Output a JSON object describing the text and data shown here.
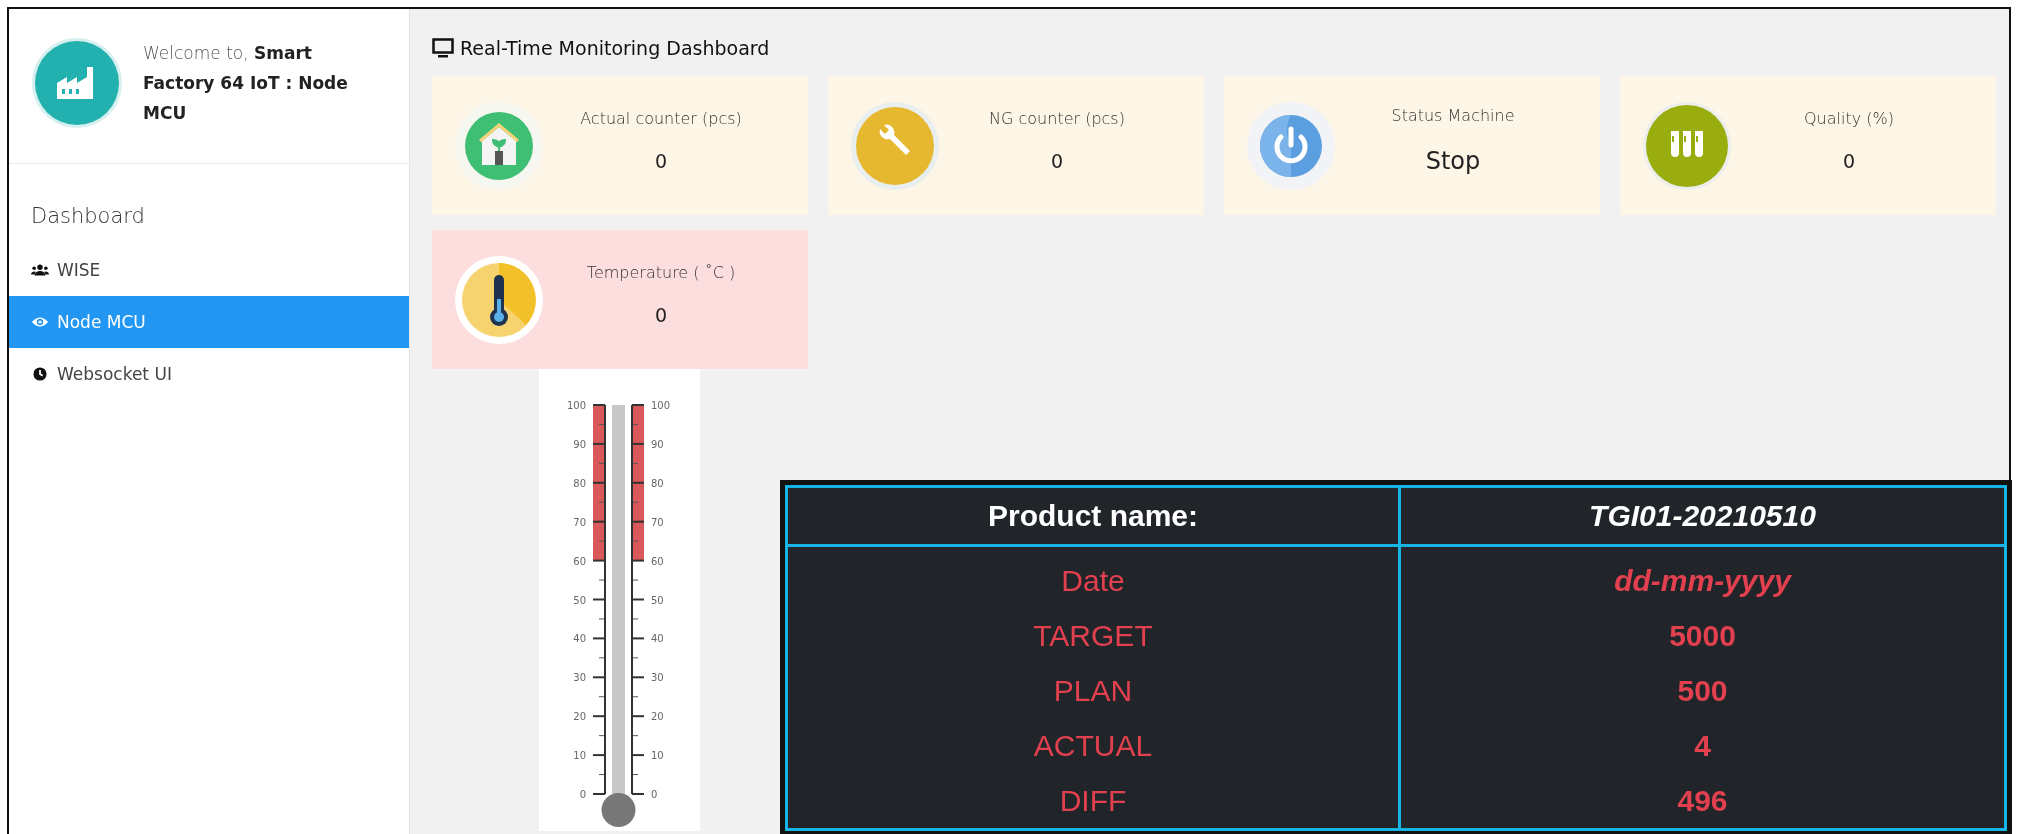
{
  "sidebar": {
    "welcome": "Welcome to, **Smart Factory 64 IoT : Node MCU**",
    "section": "Dashboard",
    "items": [
      {
        "label": "WISE",
        "selected": false
      },
      {
        "label": "Node MCU",
        "selected": true
      },
      {
        "label": "Websocket UI",
        "selected": false
      }
    ]
  },
  "title": "Real-Time Monitoring Dashboard",
  "cards": [
    {
      "label": "Actual counter (pcs)",
      "value": "0",
      "kind": "counter",
      "color": "#fdf5e6"
    },
    {
      "label": "NG counter (pcs)",
      "value": "0",
      "kind": "counter",
      "color": "#fdf5e6"
    },
    {
      "label": "Status Machine",
      "value": "Stop",
      "kind": "status",
      "color": "#fdf5e6"
    },
    {
      "label": "Quality (%)",
      "value": "0",
      "kind": "counter",
      "color": "#fdf5e6"
    },
    {
      "label": "Temperature ( ˚C )",
      "value": "0",
      "kind": "counter",
      "color": "#fddede"
    }
  ],
  "thermometer": {
    "left_ticks": [
      "100",
      "90",
      "80",
      "70",
      "60",
      "50",
      "40",
      "30",
      "20",
      "10",
      "0"
    ],
    "right_ticks": [
      "100",
      "90",
      "80",
      "70",
      "60",
      "50",
      "40",
      "30",
      "20",
      "10",
      "0"
    ]
  },
  "product_table": {
    "header": {
      "label": "Product name:",
      "value": "TGI01-20210510"
    },
    "rows": [
      {
        "label": "Date",
        "value": "dd-mm-yyyy",
        "italic": true
      },
      {
        "label": "TARGET",
        "value": "5000",
        "italic": false
      },
      {
        "label": "PLAN",
        "value": "500",
        "italic": false
      },
      {
        "label": "ACTUAL",
        "value": "4",
        "italic": false
      },
      {
        "label": "DIFF",
        "value": "496",
        "italic": false
      }
    ]
  }
}
